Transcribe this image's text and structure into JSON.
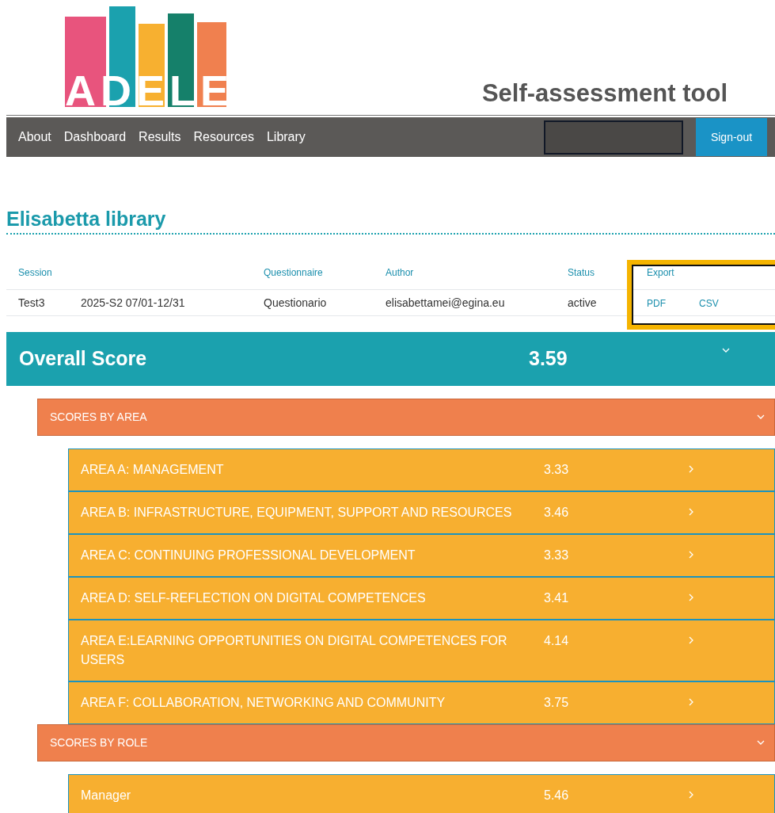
{
  "logo": {
    "text": "ADELE"
  },
  "header": {
    "title": "Self-assessment tool"
  },
  "nav": {
    "items": [
      "About",
      "Dashboard",
      "Results",
      "Resources",
      "Library"
    ],
    "sign_out": "Sign-out"
  },
  "page_title": "Elisabetta library",
  "table": {
    "columns": [
      "Session",
      "",
      "Questionnaire",
      "Author",
      "Status",
      "Export",
      ""
    ],
    "rows": [
      {
        "session": "Test3",
        "period": "2025-S2 07/01-12/31",
        "questionnaire": "Questionario",
        "author": "elisabettamei@egina.eu",
        "status": "active",
        "exports": [
          "PDF",
          "CSV"
        ]
      }
    ]
  },
  "overall": {
    "label": "Overall Score",
    "score": "3.59",
    "expanded": true
  },
  "sections": [
    {
      "label": "SCORES BY AREA",
      "expanded": true,
      "items": [
        {
          "label": "AREA A: MANAGEMENT",
          "score": "3.33"
        },
        {
          "label": "AREA B: INFRASTRUCTURE, EQUIPMENT, SUPPORT AND RESOURCES",
          "score": "3.46"
        },
        {
          "label": "AREA C: CONTINUING PROFESSIONAL DEVELOPMENT",
          "score": "3.33"
        },
        {
          "label": "AREA D: SELF-REFLECTION ON DIGITAL COMPETENCES",
          "score": "3.41"
        },
        {
          "label": "AREA E:LEARNING OPPORTUNITIES ON DIGITAL COMPETENCES FOR USERS",
          "score": "4.14"
        },
        {
          "label": "AREA F: COLLABORATION, NETWORKING AND COMMUNITY",
          "score": "3.75"
        }
      ]
    },
    {
      "label": "SCORES BY ROLE",
      "expanded": true,
      "items": [
        {
          "label": "Manager",
          "score": "5.46"
        }
      ]
    }
  ]
}
